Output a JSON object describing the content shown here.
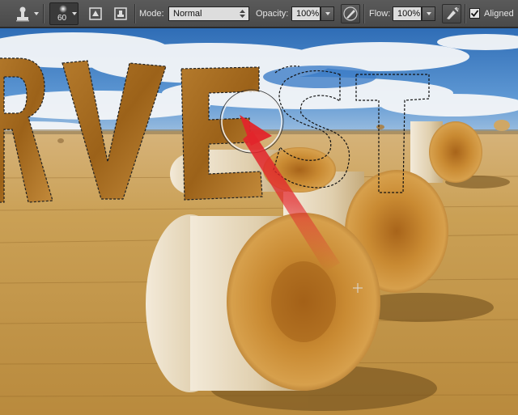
{
  "options_bar": {
    "brush_size": "60",
    "mode_label": "Mode:",
    "mode_value": "Normal",
    "opacity_label": "Opacity:",
    "opacity_value": "100%",
    "flow_label": "Flow:",
    "flow_value": "100%",
    "aligned_label": "Aligned",
    "aligned_checked": true
  },
  "canvas": {
    "text_letters": [
      "R",
      "V",
      "E",
      "S",
      "T"
    ],
    "filled_letters": [
      "R",
      "V",
      "E"
    ],
    "outlined_letters": [
      "S",
      "T"
    ],
    "annotation_arrow_color": "#e2252b",
    "sky_color": "#3d7fc7",
    "field_color": "#c99a48"
  }
}
